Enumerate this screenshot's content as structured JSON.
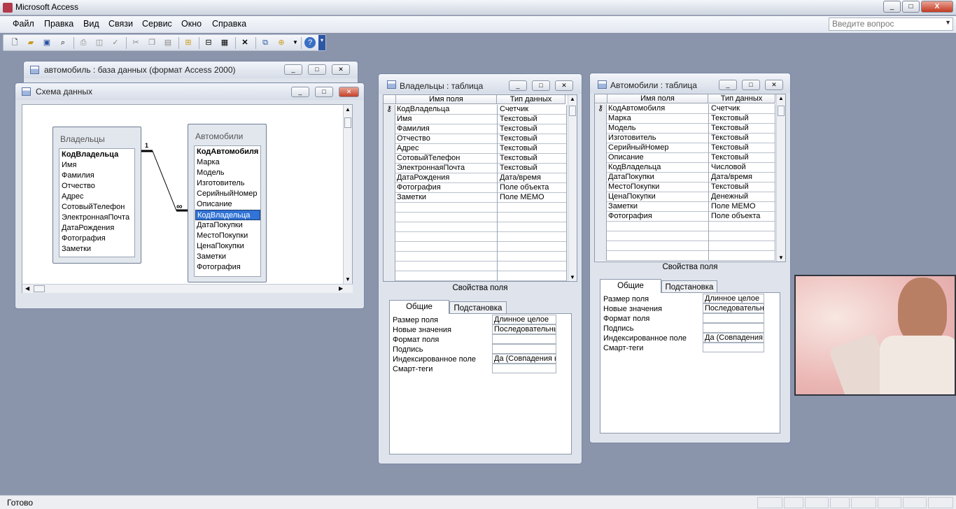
{
  "app": {
    "title": "Microsoft Access",
    "min": "_",
    "max": "□",
    "close": "X"
  },
  "menu": [
    "Файл",
    "Правка",
    "Вид",
    "Связи",
    "Сервис",
    "Окно",
    "Справка"
  ],
  "ask_placeholder": "Введите вопрос",
  "toolbar_icons": [
    "new-icon",
    "open-icon",
    "save-icon",
    "search-icon",
    "print-icon",
    "preview-icon",
    "spelling-icon",
    "cut-icon",
    "copy-icon",
    "paste-icon",
    "show-table-icon",
    "show-direct-icon",
    "show-all-icon",
    "delete-icon",
    "relationships-icon",
    "new-object-icon",
    "help-icon"
  ],
  "dbwin": {
    "title": "автомобиль : база данных (формат Access 2000)"
  },
  "schema": {
    "title": "Схема данных",
    "owners": {
      "title": "Владельцы",
      "fields": [
        "КодВладельца",
        "Имя",
        "Фамилия",
        "Отчество",
        "Адрес",
        "СотовыйТелефон",
        "ЭлектроннаяПочта",
        "ДатаРождения",
        "Фотография",
        "Заметки"
      ]
    },
    "cars": {
      "title": "Автомобили",
      "fields": [
        "КодАвтомобиля",
        "Марка",
        "Модель",
        "Изготовитель",
        "СерийныйНомер",
        "Описание",
        "КодВладельца",
        "ДатаПокупки",
        "МестоПокупки",
        "ЦенаПокупки",
        "Заметки",
        "Фотография"
      ]
    },
    "rel_one": "1",
    "rel_many": "∞"
  },
  "owners_table": {
    "title": "Владельцы : таблица",
    "h1": "Имя поля",
    "h2": "Тип данных",
    "rows": [
      [
        "КодВладельца",
        "Счетчик"
      ],
      [
        "Имя",
        "Текстовый"
      ],
      [
        "Фамилия",
        "Текстовый"
      ],
      [
        "Отчество",
        "Текстовый"
      ],
      [
        "Адрес",
        "Текстовый"
      ],
      [
        "СотовыйТелефон",
        "Текстовый"
      ],
      [
        "ЭлектроннаяПочта",
        "Текстовый"
      ],
      [
        "ДатаРождения",
        "Дата/время"
      ],
      [
        "Фотография",
        "Поле объекта"
      ],
      [
        "Заметки",
        "Поле MEMO"
      ]
    ],
    "props_title": "Свойства поля",
    "tab1": "Общие",
    "tab2": "Подстановка",
    "props": [
      [
        "Размер поля",
        "Длинное целое"
      ],
      [
        "Новые значения",
        "Последовательные"
      ],
      [
        "Формат поля",
        ""
      ],
      [
        "Подпись",
        ""
      ],
      [
        "Индексированное поле",
        "Да (Совпадения не допускаются)"
      ],
      [
        "Смарт-теги",
        ""
      ]
    ]
  },
  "cars_table": {
    "title": "Автомобили : таблица",
    "h1": "Имя поля",
    "h2": "Тип данных",
    "rows": [
      [
        "КодАвтомобиля",
        "Счетчик"
      ],
      [
        "Марка",
        "Текстовый"
      ],
      [
        "Модель",
        "Текстовый"
      ],
      [
        "Изготовитель",
        "Текстовый"
      ],
      [
        "СерийныйНомер",
        "Текстовый"
      ],
      [
        "Описание",
        "Текстовый"
      ],
      [
        "КодВладельца",
        "Числовой"
      ],
      [
        "ДатаПокупки",
        "Дата/время"
      ],
      [
        "МестоПокупки",
        "Текстовый"
      ],
      [
        "ЦенаПокупки",
        "Денежный"
      ],
      [
        "Заметки",
        "Поле MEMO"
      ],
      [
        "Фотография",
        "Поле объекта"
      ]
    ],
    "props_title": "Свойства поля",
    "tab1": "Общие",
    "tab2": "Подстановка",
    "props": [
      [
        "Размер поля",
        "Длинное целое"
      ],
      [
        "Новые значения",
        "Последовательные"
      ],
      [
        "Формат поля",
        ""
      ],
      [
        "Подпись",
        ""
      ],
      [
        "Индексированное поле",
        "Да (Совпадения не допускаются)"
      ],
      [
        "Смарт-теги",
        ""
      ]
    ]
  },
  "status": "Готово"
}
